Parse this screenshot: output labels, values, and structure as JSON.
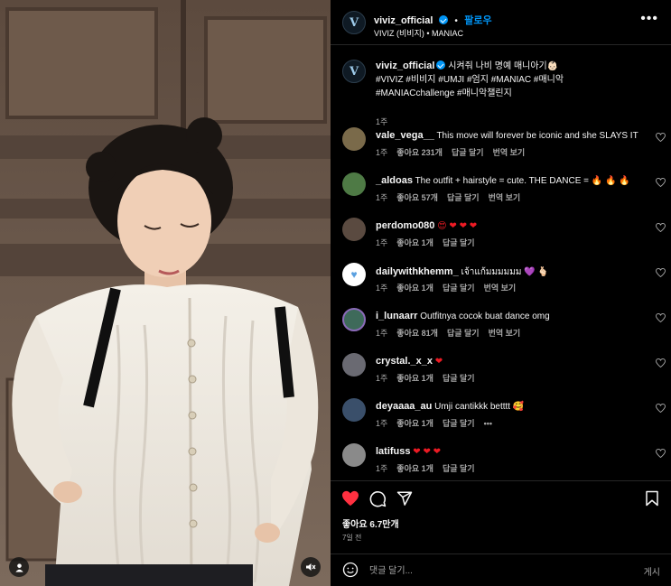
{
  "post": {
    "username": "viviz_official",
    "avatar_letter": "V",
    "follow_label": "팔로우",
    "subtitle": "VIVIZ (비비지) • MANIAC",
    "more_icon": "more-horizontal-icon",
    "caption_line1": "시켜줘 나비 명예 매니아기👶🏻",
    "caption_line2": "#VIVIZ #비비지 #UMJI #엄지 #MANIAC #매니악",
    "caption_line3": "#MANIACchallenge #매니악챌린지",
    "caption_time": "1주"
  },
  "comments": [
    {
      "user": "vale_vega__",
      "text": "This move will forever be iconic and she SLAYS IT",
      "time": "1주",
      "likes": "좋아요 231개",
      "reply": "답글 달기",
      "translate": "번역 보기",
      "avatar_color": "#7a6a4a"
    },
    {
      "user": "_aldoas",
      "text": "The outfit + hairstyle = cute. THE DANCE = 🔥 🔥 🔥",
      "time": "1주",
      "likes": "좋아요 57개",
      "reply": "답글 달기",
      "translate": "번역 보기",
      "avatar_color": "#4e7a45"
    },
    {
      "user": "perdomo080",
      "text": "😍 ❤ ❤ ❤",
      "time": "1주",
      "likes": "좋아요 1개",
      "reply": "답글 달기",
      "translate": "",
      "avatar_color": "#5a4a40"
    },
    {
      "user": "dailywithkhemm_",
      "text": "เจ้าแก้มมมมมม 💜 🫰🏻",
      "time": "1주",
      "likes": "좋아요 1개",
      "reply": "답글 달기",
      "translate": "번역 보기",
      "avatar_color": "#ffffff"
    },
    {
      "user": "i_lunaarr",
      "text": "Outfitnya cocok buat dance omg",
      "time": "1주",
      "likes": "좋아요 81개",
      "reply": "답글 달기",
      "translate": "번역 보기",
      "avatar_color": "#3e6a5a"
    },
    {
      "user": "crystal._x_x",
      "text": "❤",
      "time": "1주",
      "likes": "좋아요 1개",
      "reply": "답글 달기",
      "translate": "",
      "avatar_color": "#6a6a72"
    },
    {
      "user": "deyaaaa_au",
      "text": "Umji cantikkk betttt 🥰",
      "time": "1주",
      "likes": "좋아요 1개",
      "reply": "답글 달기",
      "translate": "•••",
      "avatar_color": "#3a4f6a"
    },
    {
      "user": "latifuss",
      "text": "❤ ❤ ❤",
      "time": "1주",
      "likes": "좋아요 1개",
      "reply": "답글 달기",
      "translate": "",
      "avatar_color": "#8a8a8a"
    }
  ],
  "actions": {
    "like_icon": "heart-filled-icon",
    "comment_icon": "comment-icon",
    "share_icon": "share-icon",
    "save_icon": "bookmark-icon",
    "likes_text": "좋아요 6.7만개",
    "date": "7일 전"
  },
  "composer": {
    "placeholder": "댓글 달기...",
    "post_label": "게시"
  },
  "colors": {
    "accent": "#0095f6",
    "like_red": "#ff3040",
    "background": "#000000"
  }
}
